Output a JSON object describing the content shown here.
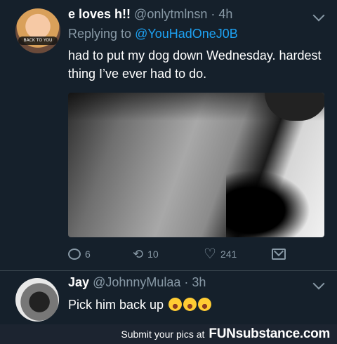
{
  "tweet": {
    "display_name": "e loves h!!",
    "handle": "@onlytmlnsn",
    "time": "· 4h",
    "replying_prefix": "Replying to",
    "replying_mention": "@YouHadOneJ0B",
    "text": "had to put my dog down Wednesday. hardest thing I’ve ever had to do.",
    "avatar_badge": "BACK TO YOU",
    "reply_count": "6",
    "retweet_count": "10",
    "like_count": "241"
  },
  "reply": {
    "display_name": "Jay",
    "handle": "@JohnnyMulaa",
    "time": "· 3h",
    "text": "Pick him back up",
    "emoji": "loudly-crying-face x3"
  },
  "footer": {
    "prefix": "Submit your pics at",
    "brand": "FUNsubstance.com"
  },
  "icons": [
    "reply-icon",
    "retweet-icon",
    "like-icon",
    "dm-icon",
    "chevron-down-icon"
  ],
  "colors": {
    "background": "#15202b",
    "muted": "#8899a6",
    "link": "#1da1f2",
    "divider": "#38444d"
  }
}
